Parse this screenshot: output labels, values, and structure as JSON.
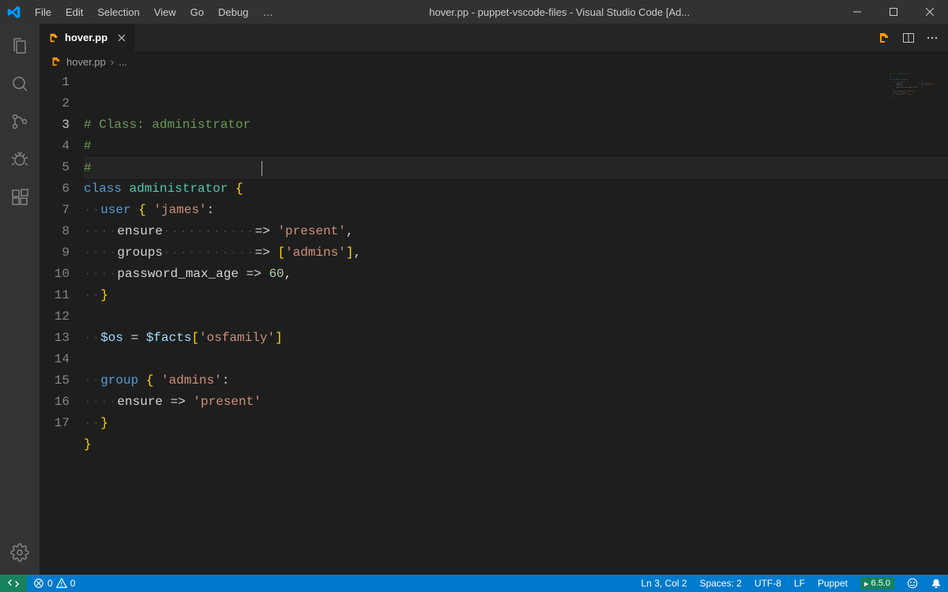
{
  "titlebar": {
    "menu": [
      "File",
      "Edit",
      "Selection",
      "View",
      "Go",
      "Debug",
      "…"
    ],
    "title": "hover.pp - puppet-vscode-files - Visual Studio Code [Ad..."
  },
  "tab": {
    "label": "hover.pp"
  },
  "breadcrumb": {
    "file": "hover.pp",
    "trail": "..."
  },
  "editor": {
    "current_line": 3,
    "lines": [
      {
        "n": 1,
        "segs": [
          {
            "t": "# Class: administrator",
            "c": "comment"
          }
        ]
      },
      {
        "n": 2,
        "segs": [
          {
            "t": "#",
            "c": "comment"
          }
        ]
      },
      {
        "n": 3,
        "segs": [
          {
            "t": "#",
            "c": "comment"
          }
        ]
      },
      {
        "n": 4,
        "segs": [
          {
            "t": "class",
            "c": "keyword"
          },
          {
            "t": " ",
            "c": "punc"
          },
          {
            "t": "administrator",
            "c": "type"
          },
          {
            "t": " ",
            "c": "punc"
          },
          {
            "t": "{",
            "c": "brace"
          }
        ]
      },
      {
        "n": 5,
        "segs": [
          {
            "t": "··",
            "c": "dots"
          },
          {
            "t": "user",
            "c": "keyword"
          },
          {
            "t": " ",
            "c": "punc"
          },
          {
            "t": "{",
            "c": "brace"
          },
          {
            "t": " ",
            "c": "punc"
          },
          {
            "t": "'james'",
            "c": "string"
          },
          {
            "t": ":",
            "c": "punc"
          }
        ]
      },
      {
        "n": 6,
        "segs": [
          {
            "t": "····",
            "c": "dots"
          },
          {
            "t": "ensure",
            "c": "punc"
          },
          {
            "t": "···········",
            "c": "dots"
          },
          {
            "t": "=> ",
            "c": "punc"
          },
          {
            "t": "'present'",
            "c": "string"
          },
          {
            "t": ",",
            "c": "punc"
          }
        ]
      },
      {
        "n": 7,
        "segs": [
          {
            "t": "····",
            "c": "dots"
          },
          {
            "t": "groups",
            "c": "punc"
          },
          {
            "t": "···········",
            "c": "dots"
          },
          {
            "t": "=> ",
            "c": "punc"
          },
          {
            "t": "[",
            "c": "brace"
          },
          {
            "t": "'admins'",
            "c": "string"
          },
          {
            "t": "]",
            "c": "brace"
          },
          {
            "t": ",",
            "c": "punc"
          }
        ]
      },
      {
        "n": 8,
        "segs": [
          {
            "t": "····",
            "c": "dots"
          },
          {
            "t": "password_max_age => ",
            "c": "punc"
          },
          {
            "t": "60",
            "c": "number"
          },
          {
            "t": ",",
            "c": "punc"
          }
        ]
      },
      {
        "n": 9,
        "segs": [
          {
            "t": "··",
            "c": "dots"
          },
          {
            "t": "}",
            "c": "brace"
          }
        ]
      },
      {
        "n": 10,
        "segs": []
      },
      {
        "n": 11,
        "segs": [
          {
            "t": "··",
            "c": "dots"
          },
          {
            "t": "$os",
            "c": "var"
          },
          {
            "t": " = ",
            "c": "punc"
          },
          {
            "t": "$facts",
            "c": "var"
          },
          {
            "t": "[",
            "c": "brace"
          },
          {
            "t": "'osfamily'",
            "c": "string"
          },
          {
            "t": "]",
            "c": "brace"
          }
        ]
      },
      {
        "n": 12,
        "segs": []
      },
      {
        "n": 13,
        "segs": [
          {
            "t": "··",
            "c": "dots"
          },
          {
            "t": "group",
            "c": "keyword"
          },
          {
            "t": " ",
            "c": "punc"
          },
          {
            "t": "{",
            "c": "brace"
          },
          {
            "t": " ",
            "c": "punc"
          },
          {
            "t": "'admins'",
            "c": "string"
          },
          {
            "t": ":",
            "c": "punc"
          }
        ]
      },
      {
        "n": 14,
        "segs": [
          {
            "t": "····",
            "c": "dots"
          },
          {
            "t": "ensure => ",
            "c": "punc"
          },
          {
            "t": "'present'",
            "c": "string"
          }
        ]
      },
      {
        "n": 15,
        "segs": [
          {
            "t": "··",
            "c": "dots"
          },
          {
            "t": "}",
            "c": "brace"
          }
        ]
      },
      {
        "n": 16,
        "segs": [
          {
            "t": "}",
            "c": "brace"
          }
        ]
      },
      {
        "n": 17,
        "segs": []
      }
    ]
  },
  "status": {
    "errors": "0",
    "warnings": "0",
    "position": "Ln 3, Col 2",
    "spaces": "Spaces: 2",
    "encoding": "UTF-8",
    "eol": "LF",
    "language": "Puppet",
    "version": "6.5.0"
  }
}
